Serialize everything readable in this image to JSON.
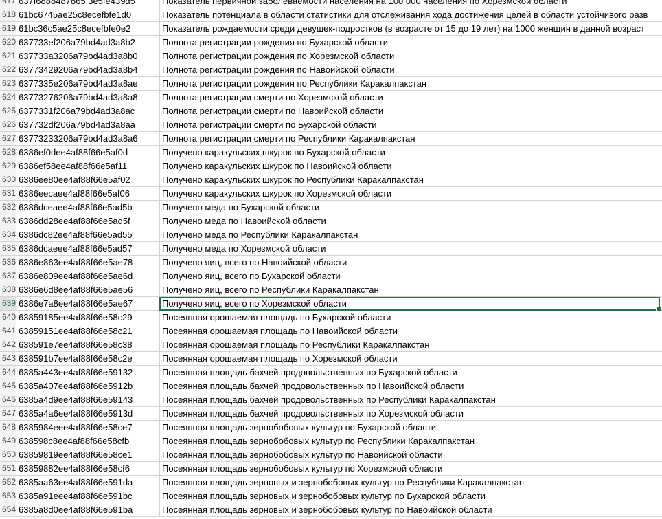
{
  "selected_row": "639",
  "rows": [
    {
      "num": "617",
      "id": "637f6888487865 3e5fe439d5",
      "name": "Показатель первичной заболеваемости населения на 100 000 населения по Хорезмской области"
    },
    {
      "num": "618",
      "id": "61bc6745ae25c8ecefbfe1d0",
      "name": "Показатель потенциала в области статистики для отслеживания хода достижения целей в области устойчивого разв"
    },
    {
      "num": "619",
      "id": "61bc36c5ae25c8ecefbfe0e2",
      "name": "Показатель рождаемости среди девушек-подростков (в возрасте от 15 до 19 лет) на 1000 женщин в данной возраст"
    },
    {
      "num": "620",
      "id": "637733ef206a79bd4ad3a8b2",
      "name": "Полнота регистрации рождения  по Бухарской области"
    },
    {
      "num": "621",
      "id": "637733a3206a79bd4ad3a8b0",
      "name": "Полнота регистрации рождения  по Хорезмской области"
    },
    {
      "num": "622",
      "id": "63773429206a79bd4ad3a8b4",
      "name": "Полнота регистрации рождения по  Навоийской области"
    },
    {
      "num": "623",
      "id": "6377335e206a79bd4ad3a8ae",
      "name": "Полнота регистрации рождения по Республики Каракалпакстан"
    },
    {
      "num": "624",
      "id": "63773276206a79bd4ad3a8a8",
      "name": "Полнота регистрации смерти   по Хорезмской области"
    },
    {
      "num": "625",
      "id": "6377331f206a79bd4ad3a8ac",
      "name": "Полнота регистрации смерти по  Навоийской области"
    },
    {
      "num": "626",
      "id": "637732df206a79bd4ad3a8aa",
      "name": "Полнота регистрации смерти по Бухарской области"
    },
    {
      "num": "627",
      "id": "63773233206a79bd4ad3a8a6",
      "name": "Полнота регистрации смерти по Республики Каракалпакстан"
    },
    {
      "num": "628",
      "id": "6386ef0dee4af88f66e5af0d",
      "name": "Получено каракульских шкурок по Бухарской области"
    },
    {
      "num": "629",
      "id": "6386ef58ee4af88f66e5af11",
      "name": "Получено каракульских шкурок по Навоийской области"
    },
    {
      "num": "630",
      "id": "6386ee80ee4af88f66e5af02",
      "name": "Получено каракульских шкурок по Республики Каракалпакстан"
    },
    {
      "num": "631",
      "id": "6386eecaee4af88f66e5af06",
      "name": "Получено каракульских шкурок по Хорезмской области"
    },
    {
      "num": "632",
      "id": "6386dceaee4af88f66e5ad5b",
      "name": "Получено меда по Бухарской области"
    },
    {
      "num": "633",
      "id": "6386dd28ee4af88f66e5ad5f",
      "name": "Получено меда по Навоийской области"
    },
    {
      "num": "634",
      "id": "6386dc82ee4af88f66e5ad55",
      "name": "Получено меда по Республики Каракалпакстан"
    },
    {
      "num": "635",
      "id": "6386dcaeee4af88f66e5ad57",
      "name": "Получено меда по Хорезмской области"
    },
    {
      "num": "636",
      "id": "6386e863ee4af88f66e5ae78",
      "name": "Получено яиц, всего  по Навоийской области"
    },
    {
      "num": "637",
      "id": "6386e809ee4af88f66e5ae6d",
      "name": "Получено яиц, всего по Бухарской области"
    },
    {
      "num": "638",
      "id": "6386e6d8ee4af88f66e5ae56",
      "name": "Получено яиц, всего по Республики Каракалпакстан"
    },
    {
      "num": "639",
      "id": "6386e7a8ee4af88f66e5ae67",
      "name": "Получено яиц, всего по Хорезмской области"
    },
    {
      "num": "640",
      "id": "63859185ee4af88f66e58c29",
      "name": "Посеянная орошаемая площадь по Бухарской области"
    },
    {
      "num": "641",
      "id": "63859151ee4af88f66e58c21",
      "name": "Посеянная орошаемая площадь по Навоийской области"
    },
    {
      "num": "642",
      "id": "638591e7ee4af88f66e58c38",
      "name": "Посеянная орошаемая площадь по Республики Каракалпакстан"
    },
    {
      "num": "643",
      "id": "638591b7ee4af88f66e58c2e",
      "name": "Посеянная орошаемая площадь по Хорезмской области"
    },
    {
      "num": "644",
      "id": "6385a443ee4af88f66e59132",
      "name": "Посеянная площадь бахчей продовольственных по Бухарской области"
    },
    {
      "num": "645",
      "id": "6385a407ee4af88f66e5912b",
      "name": "Посеянная площадь бахчей продовольственных по Навоийской области"
    },
    {
      "num": "646",
      "id": "6385a4d9ee4af88f66e59143",
      "name": "Посеянная площадь бахчей продовольственных по Республики Каракалпакстан"
    },
    {
      "num": "647",
      "id": "6385a4a6ee4af88f66e5913d",
      "name": "Посеянная площадь бахчей продовольственных по Хорезмской области"
    },
    {
      "num": "648",
      "id": "6385984eee4af88f66e58ce7",
      "name": "Посеянная площадь зернобобовых культур  по Бухарской области"
    },
    {
      "num": "649",
      "id": "638598c8ee4af88f66e58cfb",
      "name": "Посеянная площадь зернобобовых культур  по Республики Каракалпакстан"
    },
    {
      "num": "650",
      "id": "63859819ee4af88f66e58ce1",
      "name": "Посеянная площадь зернобобовых культур по Навоийской области"
    },
    {
      "num": "651",
      "id": "63859882ee4af88f66e58cf6",
      "name": "Посеянная площадь зернобобовых культур по Хорезмской области"
    },
    {
      "num": "652",
      "id": "6385aa63ee4af88f66e591da",
      "name": "Посеянная площадь зерновых и зернобобовых культур  по Республики Каракалпакстан"
    },
    {
      "num": "653",
      "id": "6385a91eee4af88f66e591bc",
      "name": "Посеянная площадь зерновых и зернобобовых культур по Бухарской области"
    },
    {
      "num": "654",
      "id": "6385a8d0ee4af88f66e591ba",
      "name": "Посеянная площадь зерновых и зернобобовых культур по Навоийской области"
    }
  ]
}
